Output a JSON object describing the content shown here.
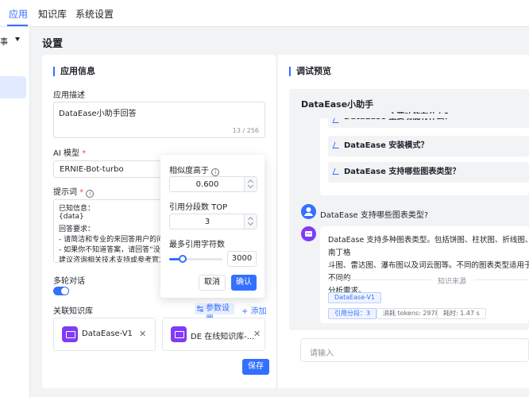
{
  "nav": {
    "tabs": [
      {
        "label": "应用",
        "active": true
      },
      {
        "label": "知识库",
        "active": false
      },
      {
        "label": "系统设置",
        "active": false
      }
    ]
  },
  "sidebar": {
    "selector_text": "事"
  },
  "page": {
    "title": "设置"
  },
  "app_info": {
    "section_title": "应用信息",
    "desc_label": "应用描述",
    "desc_value": "DataEase小助手回答",
    "desc_count": "13 / 256",
    "model_label": "AI 模型",
    "model_value": "ERNIE-Bot-turbo",
    "prompt_label": "提示词",
    "prompt_lines": [
      "已知信息：",
      "{data}",
      "回答要求：",
      "- 请简洁和专业的来回答用户的问",
      "- 如果你不知道答案，请回答“没有",
      "建议咨询相关技术支持或参考官方"
    ],
    "multi_turn_label": "多轮对话",
    "multi_turn_on": true,
    "kb_label": "关联知识库",
    "param_btn": "参数设置",
    "add_btn": "+ 添加",
    "kb_items": [
      "DataEase-V1",
      "DE 在线知识库-..."
    ],
    "save_btn": "保存"
  },
  "popover": {
    "similarity_label": "相似度高于",
    "similarity_value": "0.600",
    "topn_label": "引用分段数 TOP",
    "topn_value": "3",
    "max_chars_label": "最多引用字符数",
    "max_chars_value": "3000",
    "max_chars_fraction": 0.25,
    "cancel": "取消",
    "confirm": "确认"
  },
  "preview": {
    "section_title": "调试预览",
    "app_name": "DataEase小助手",
    "suggestions": [
      "DataEase 主要功能有什么？",
      "DataEase 安装模式？",
      "DataEase 支持哪些图表类型？"
    ],
    "user_question": "DataEase 支持哪些图表类型?",
    "answer_lines": [
      "DataEase 支持多种图表类型。包括饼图、柱状图、折线图、南丁格",
      "斗图、雷达图、瀑布图以及词云图等。不同的图表类型适用于不同的",
      "分析需求。"
    ],
    "source_label": "知识来源",
    "source_tag": "DataEase-V1",
    "ref_tag": "引用分段：3",
    "tokens_tag": "消耗 tokens: 2978",
    "time_tag": "耗时: 1.47 s",
    "input_placeholder": "请输入"
  },
  "colors": {
    "accent": "#3370ff",
    "kb_icon": "#7f3bf5",
    "user_avatar": "#3370ff",
    "bot_avatar": "#7f3bf5"
  }
}
